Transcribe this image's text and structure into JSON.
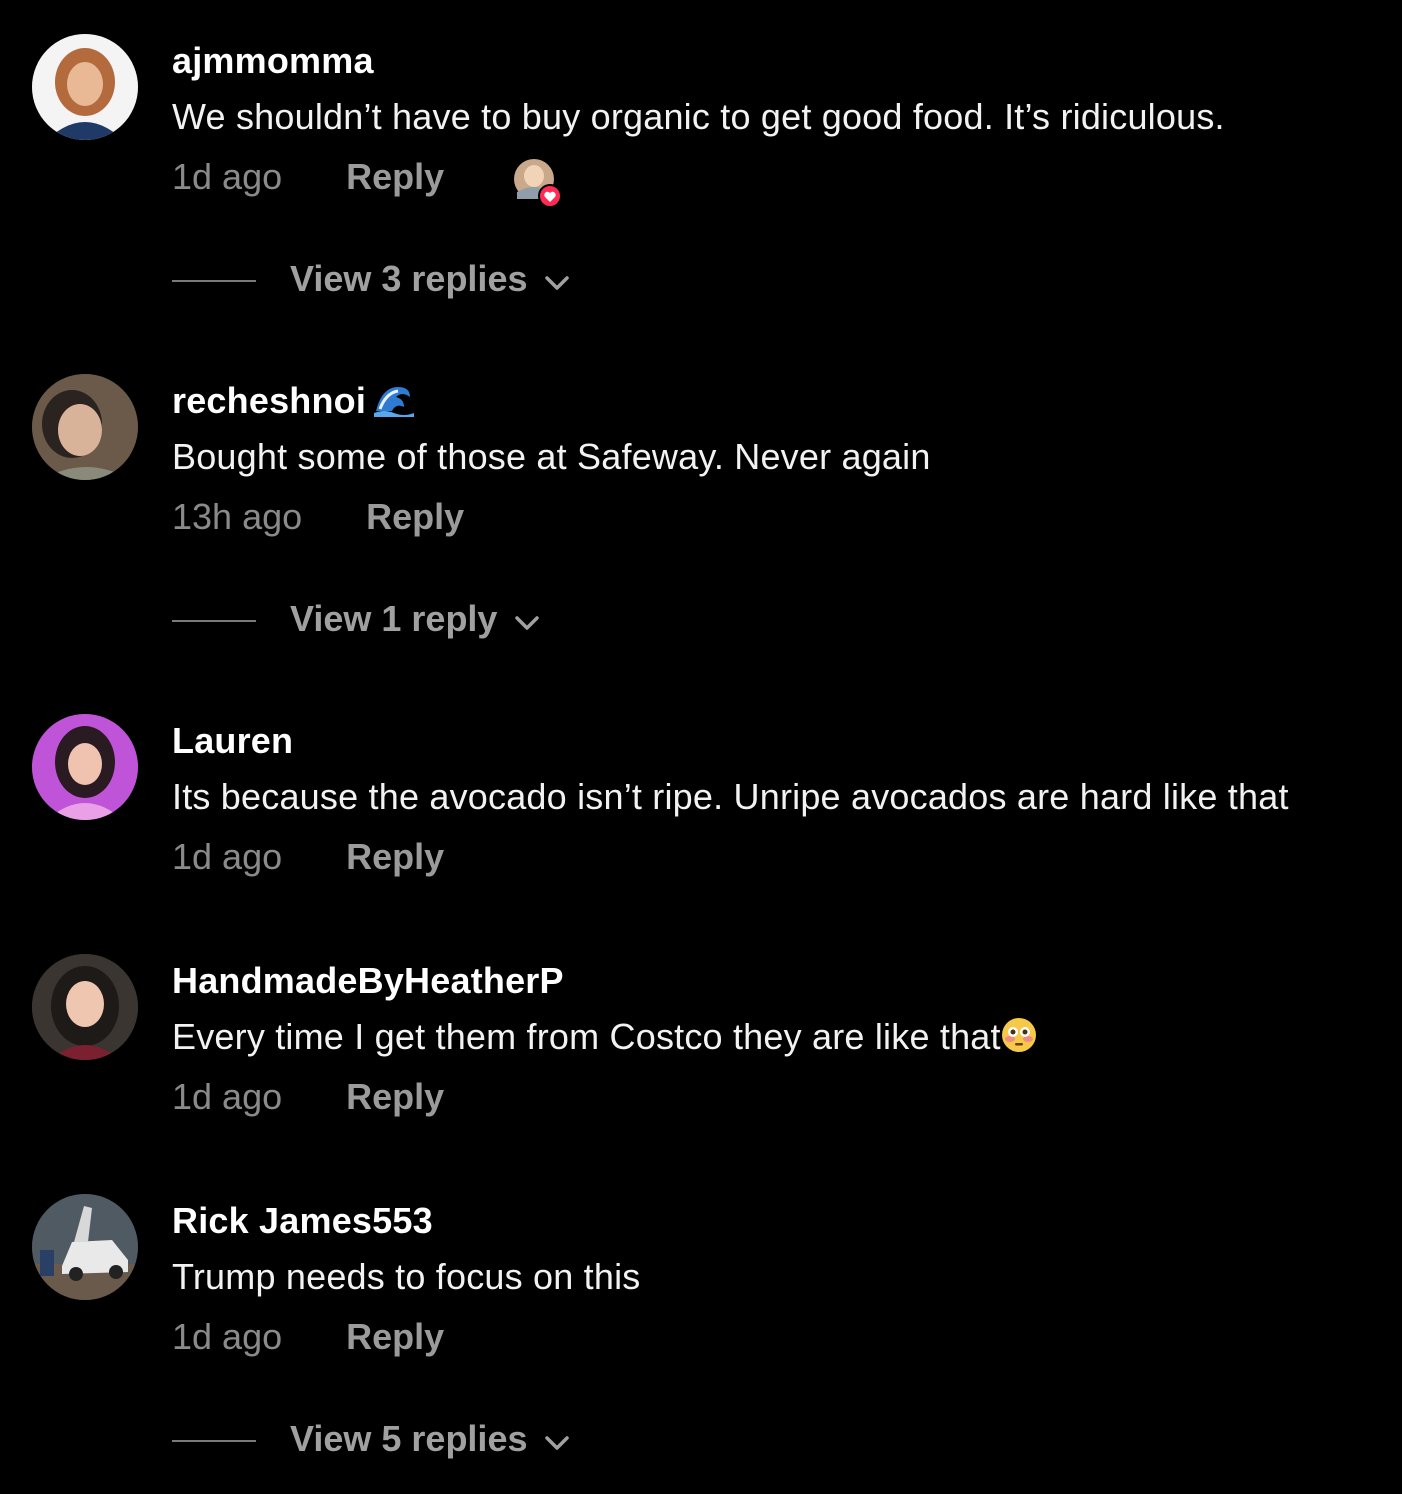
{
  "comments": [
    {
      "username": "ajmmomma",
      "text": "We shouldn’t have to buy organic to get good food. It’s ridiculous.",
      "time": "1d ago",
      "reply_label": "Reply",
      "view_replies": "View 3 replies"
    },
    {
      "username": "recheshnoi",
      "text": "Bought some of those at Safeway. Never again",
      "time": "13h ago",
      "reply_label": "Reply",
      "view_replies": "View 1 reply"
    },
    {
      "username": "Lauren",
      "text": "Its because the avocado isn’t ripe. Unripe avocados are hard like that",
      "time": "1d ago",
      "reply_label": "Reply"
    },
    {
      "username": "HandmadeByHeatherP",
      "text": "Every time I get them from Costco they are like that",
      "time": "1d ago",
      "reply_label": "Reply"
    },
    {
      "username": "Rick James553",
      "text": "Trump needs to focus on this",
      "time": "1d ago",
      "reply_label": "Reply",
      "view_replies": "View 5 replies"
    }
  ],
  "icons": {
    "wave_badge": "wave-emoji-icon",
    "flushed_emoji": "flushed-face-emoji-icon",
    "liked_by_creator": "creator-liked-heart-icon",
    "chevron": "chevron-down-icon"
  },
  "colors": {
    "background": "#000000",
    "heart": "#fe2c55"
  }
}
